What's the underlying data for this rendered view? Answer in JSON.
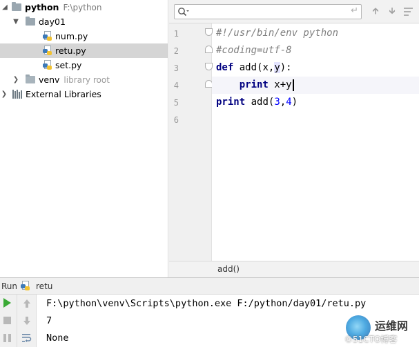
{
  "project_tree": {
    "root": {
      "name": "python",
      "path": "F:\\python"
    },
    "folder_day01": "day01",
    "files": [
      "num.py",
      "retu.py",
      "set.py"
    ],
    "selected_file": "retu.py",
    "venv": {
      "name": "venv",
      "hint": "library root"
    },
    "external_libraries": "External Libraries"
  },
  "editor": {
    "search": {
      "value": "",
      "placeholder": ""
    },
    "line_numbers": [
      "1",
      "2",
      "3",
      "4",
      "5",
      "6"
    ],
    "code": {
      "line1": "#!/usr/bin/env python",
      "line2": "#coding=utf-8",
      "line3": {
        "keyword": "def",
        "rest": " add(x,",
        "param": "y",
        "close": "):"
      },
      "line4": {
        "indent": "    ",
        "keyword": "print",
        "expr": " x+y"
      },
      "line5": {
        "keyword": "print",
        "call": " add(",
        "arg1": "3",
        "sep": ",",
        "arg2": "4",
        "close": ")"
      }
    },
    "breadcrumb": "add()"
  },
  "run_panel": {
    "title": "Run",
    "config": "retu",
    "output": [
      "F:\\python\\venv\\Scripts\\python.exe F:/python/day01/retu.py",
      "7",
      "None"
    ]
  },
  "watermark": {
    "title": "运维网",
    "subtitle": "©51CTO博客"
  },
  "colors": {
    "keyword": "#000080",
    "number": "#0000ff",
    "comment": "#808080",
    "selection": "#d5d5d5",
    "run_green": "#3aaa35"
  }
}
